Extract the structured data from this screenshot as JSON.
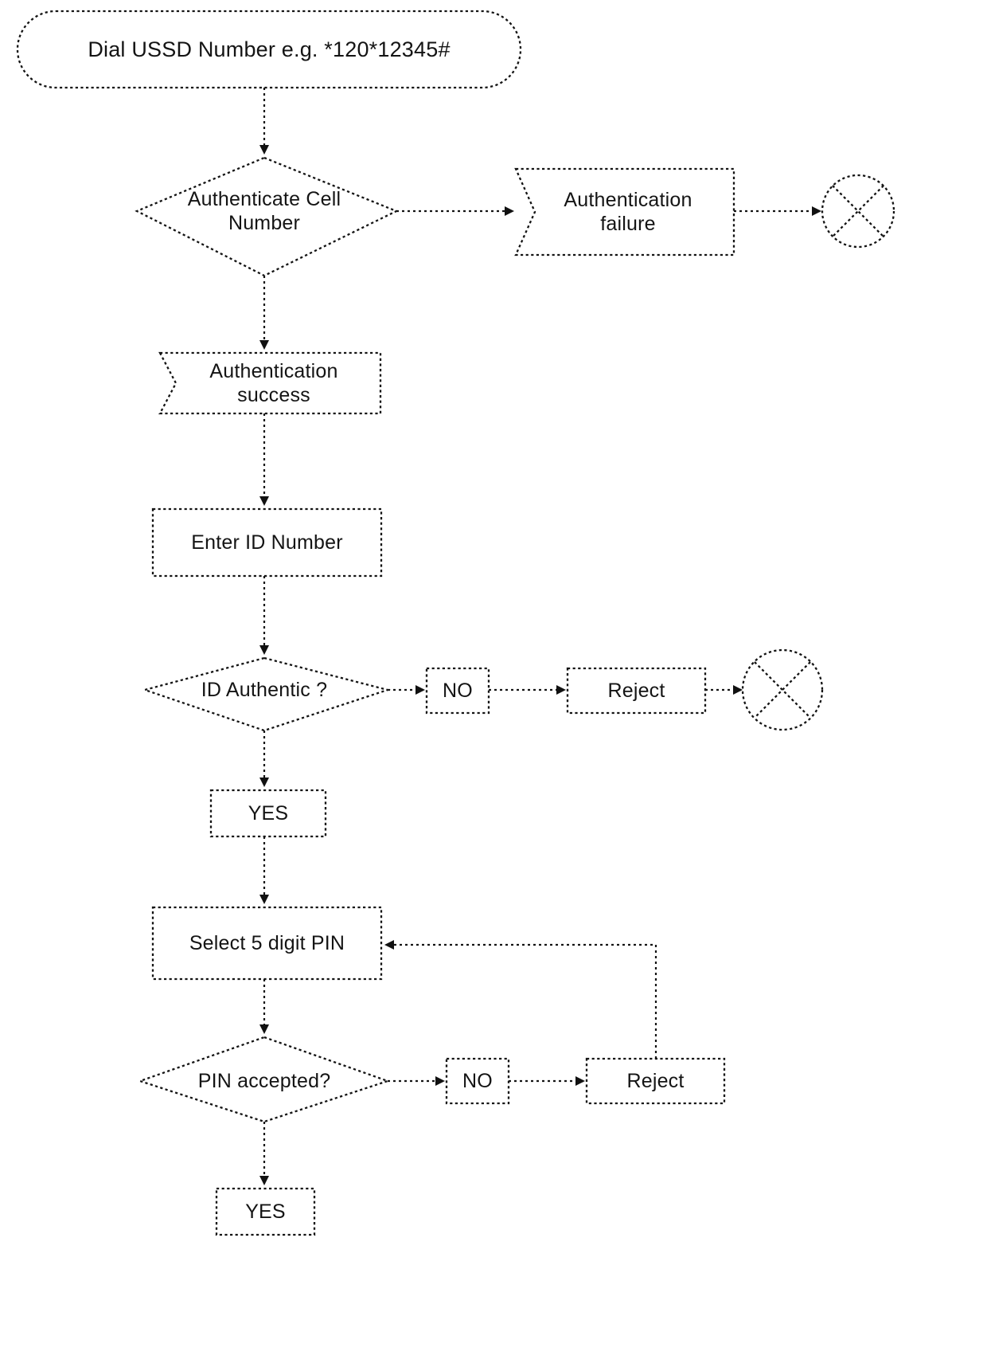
{
  "diagram": {
    "kind": "flowchart",
    "title": "USSD registration and PIN selection flow",
    "line_style": "dotted",
    "stroke_color": "#121212",
    "fill_color": "#ffffff",
    "background": "#ffffff"
  },
  "nodes": {
    "start": {
      "label": "Dial USSD Number e.g. *120*12345#",
      "shape": "stadium"
    },
    "auth_cell": {
      "label": "Authenticate Cell Number",
      "label_line1": "Authenticate Cell",
      "label_line2": "Number",
      "shape": "diamond"
    },
    "auth_failure": {
      "label": "Authentication failure",
      "label_line1": "Authentication",
      "label_line2": "failure",
      "shape": "signal"
    },
    "end_failure": {
      "label": "",
      "shape": "crossed-circle"
    },
    "auth_success": {
      "label": "Authentication success",
      "label_line1": "Authentication",
      "label_line2": "success",
      "shape": "signal"
    },
    "enter_id": {
      "label": "Enter ID Number",
      "shape": "rectangle"
    },
    "id_authentic": {
      "label": "ID Authentic ?",
      "shape": "diamond"
    },
    "id_no": {
      "label": "NO",
      "shape": "rectangle"
    },
    "id_reject": {
      "label": "Reject",
      "shape": "rectangle"
    },
    "end_reject": {
      "label": "",
      "shape": "crossed-circle"
    },
    "id_yes": {
      "label": "YES",
      "shape": "rectangle"
    },
    "select_pin": {
      "label": "Select 5 digit PIN",
      "shape": "rectangle"
    },
    "pin_accepted": {
      "label": "PIN accepted?",
      "shape": "diamond"
    },
    "pin_no": {
      "label": "NO",
      "shape": "rectangle"
    },
    "pin_reject": {
      "label": "Reject",
      "shape": "rectangle"
    },
    "pin_yes": {
      "label": "YES",
      "shape": "rectangle"
    }
  },
  "edges": [
    {
      "from": "start",
      "to": "auth_cell",
      "label": ""
    },
    {
      "from": "auth_cell",
      "to": "auth_failure",
      "label": ""
    },
    {
      "from": "auth_failure",
      "to": "end_failure",
      "label": ""
    },
    {
      "from": "auth_cell",
      "to": "auth_success",
      "label": ""
    },
    {
      "from": "auth_success",
      "to": "enter_id",
      "label": ""
    },
    {
      "from": "enter_id",
      "to": "id_authentic",
      "label": ""
    },
    {
      "from": "id_authentic",
      "to": "id_no",
      "label": ""
    },
    {
      "from": "id_no",
      "to": "id_reject",
      "label": ""
    },
    {
      "from": "id_reject",
      "to": "end_reject",
      "label": ""
    },
    {
      "from": "id_authentic",
      "to": "id_yes",
      "label": ""
    },
    {
      "from": "id_yes",
      "to": "select_pin",
      "label": ""
    },
    {
      "from": "select_pin",
      "to": "pin_accepted",
      "label": ""
    },
    {
      "from": "pin_accepted",
      "to": "pin_no",
      "label": ""
    },
    {
      "from": "pin_no",
      "to": "pin_reject",
      "label": ""
    },
    {
      "from": "pin_reject",
      "to": "select_pin",
      "label": ""
    },
    {
      "from": "pin_accepted",
      "to": "pin_yes",
      "label": ""
    }
  ]
}
